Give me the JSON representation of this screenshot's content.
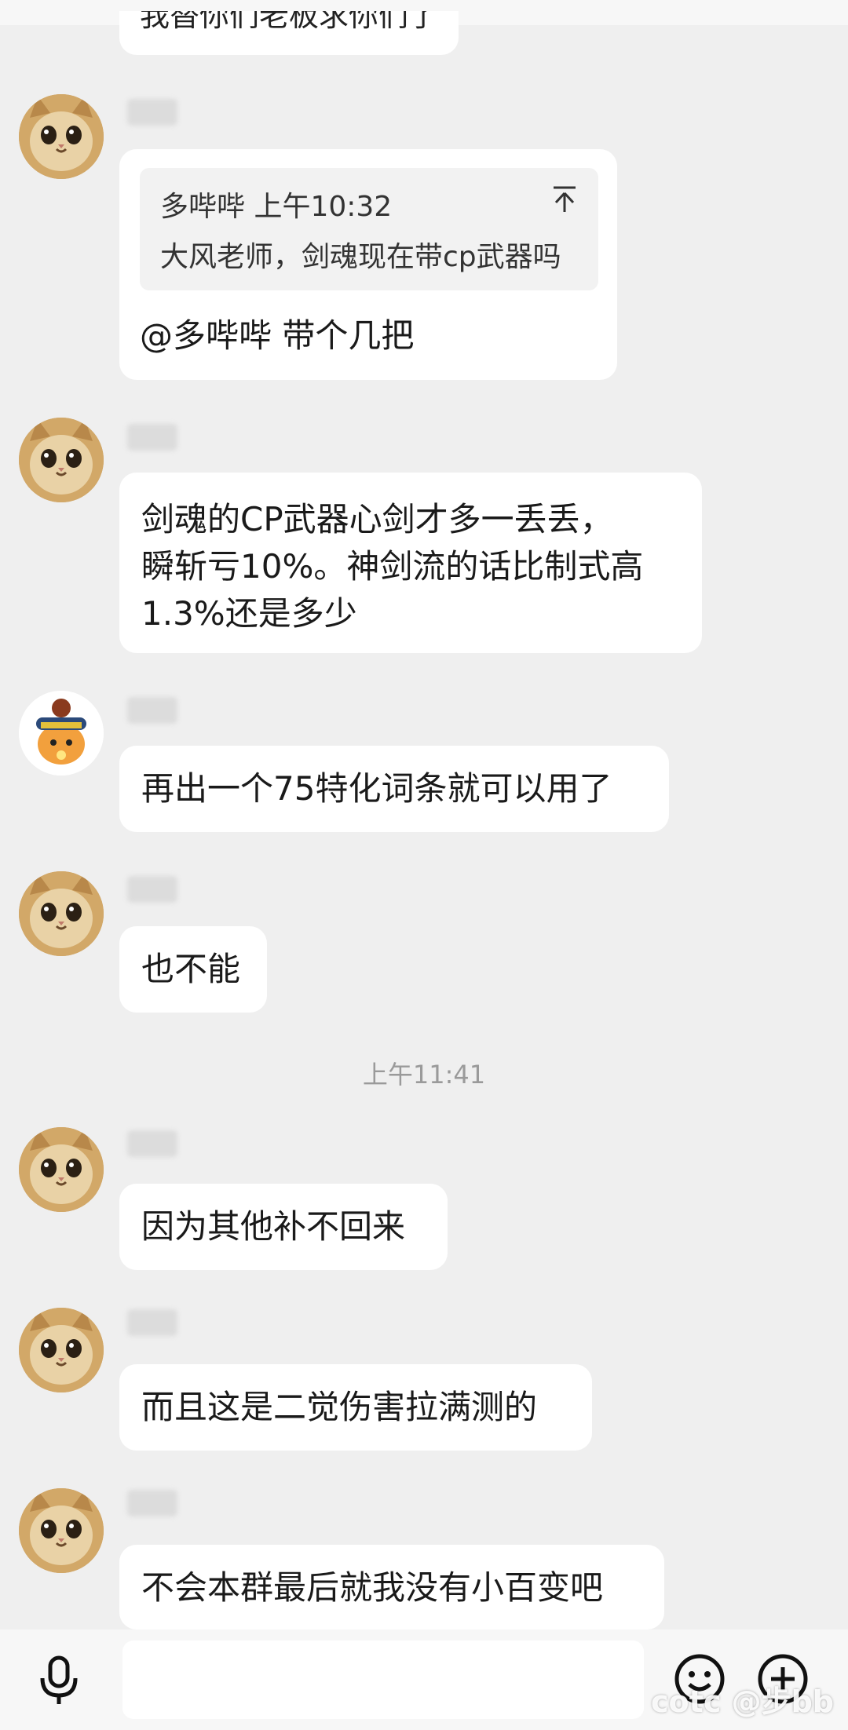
{
  "chat": {
    "cut_off_message": "我替你们老板求你们了",
    "time_divider": "上午11:41",
    "reply": {
      "quoted_sender": "多哔哔",
      "quoted_time": "上午10:32",
      "quoted_text": "大风老师，剑魂现在带cp武器吗",
      "reply_text": "@多哔哔 带个几把"
    },
    "messages": [
      {
        "text_lines": [
          "剑魂的CP武器心剑才多一丢丢，",
          "瞬斩亏10%。神剑流的话比制式高",
          "1.3%还是多少"
        ]
      },
      {
        "text": "再出一个75特化词条就可以用了"
      },
      {
        "text": "也不能"
      },
      {
        "text": "因为其他补不回来"
      },
      {
        "text": "而且这是二觉伤害拉满测的"
      },
      {
        "text": "不会本群最后就我没有小百变吧"
      }
    ]
  },
  "icons": {
    "pin": "pin-top-icon",
    "mic": "microphone-icon",
    "emoji": "emoji-icon",
    "plus": "plus-icon"
  },
  "watermark": "cotc @步bb",
  "colors": {
    "background": "#efefef",
    "bubble": "#ffffff",
    "quote_bg": "#f2f2f2",
    "timestamp": "#9a9a9a"
  }
}
